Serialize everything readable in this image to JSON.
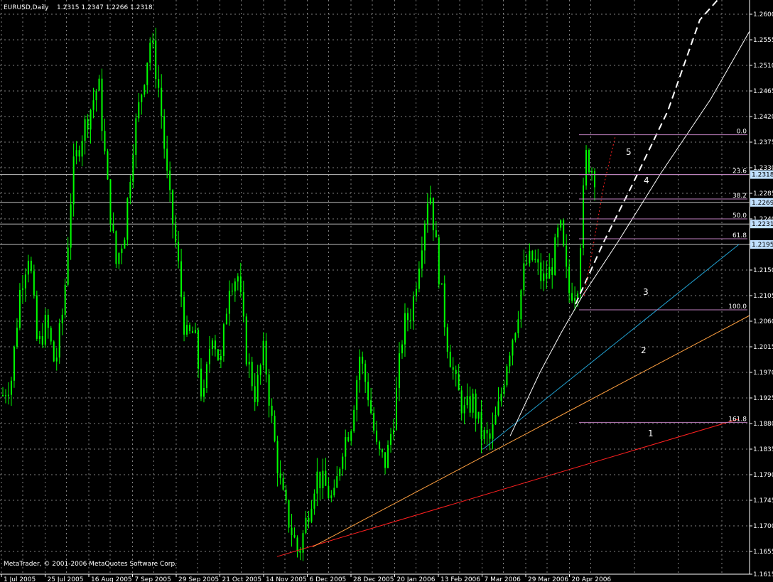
{
  "header": {
    "symbol_text": "EURUSD,Daily",
    "ohlc_text": "1.2315 1.2347 1.2266 1.2318"
  },
  "footer": {
    "copyright": "MetaTrader, © 2001-2006 MetaQuotes Software Corp."
  },
  "chart_data": {
    "type": "candlestick",
    "y_axis": {
      "min": 1.1615,
      "max": 1.2625,
      "ticks": [
        "1.2600",
        "1.2555",
        "1.2510",
        "1.2465",
        "1.2420",
        "1.2375",
        "1.2330",
        "1.2285",
        "1.2240",
        "1.2195",
        "1.2150",
        "1.2105",
        "1.2060",
        "1.2015",
        "1.1970",
        "1.1925",
        "1.1880",
        "1.1835",
        "1.1790",
        "1.1745",
        "1.1700",
        "1.1655",
        "1.1615"
      ]
    },
    "x_axis": {
      "ticks": [
        "1 Jul 2005",
        "25 Jul 2005",
        "16 Aug 2005",
        "7 Sep 2005",
        "29 Sep 2005",
        "21 Oct 2005",
        "14 Nov 2005",
        "6 Dec 2005",
        "28 Dec 2005",
        "20 Jan 2006",
        "13 Feb 2006",
        "7 Mar 2006",
        "29 Mar 2006",
        "20 Apr 2006"
      ]
    },
    "grid": true,
    "series_color": "#00ff00",
    "price_path": [
      1.193,
      1.196,
      1.212,
      1.2185,
      1.201,
      1.206,
      1.198,
      1.209,
      1.232,
      1.2385,
      1.243,
      1.248,
      1.23,
      1.216,
      1.222,
      1.238,
      1.247,
      1.256,
      1.246,
      1.229,
      1.218,
      1.203,
      1.204,
      1.191,
      1.205,
      1.198,
      1.213,
      1.214,
      1.2,
      1.193,
      1.201,
      1.187,
      1.176,
      1.17,
      1.165,
      1.172,
      1.179,
      1.177,
      1.174,
      1.184,
      1.188,
      1.2,
      1.193,
      1.183,
      1.181,
      1.19,
      1.205,
      1.208,
      1.219,
      1.23,
      1.216,
      1.203,
      1.195,
      1.19,
      1.192,
      1.186,
      1.185,
      1.191,
      1.2,
      1.206,
      1.216,
      1.217,
      1.213,
      1.215,
      1.223,
      1.211,
      1.212,
      1.235,
      1.2318
    ],
    "fibonacci": {
      "levels": [
        {
          "label": "0.0",
          "price": 1.2388
        },
        {
          "label": "23.6",
          "price": 1.2318
        },
        {
          "label": "38.2",
          "price": 1.2275
        },
        {
          "label": "50.0",
          "price": 1.224
        },
        {
          "label": "61.8",
          "price": 1.2205
        },
        {
          "label": "100.0",
          "price": 1.208
        },
        {
          "label": "161.8",
          "price": 1.1882
        }
      ]
    },
    "price_badges": [
      "1.2318",
      "1.2269",
      "1.2231",
      "1.2195"
    ],
    "horizontal_lines": [
      1.2318,
      1.2269,
      1.2231,
      1.2195
    ],
    "trendlines": [
      {
        "label": "1",
        "color": "#ff2020",
        "dashed": false
      },
      {
        "label": "2",
        "color": "#ffa040",
        "dashed": false
      },
      {
        "label": "3",
        "color": "#20a0d0",
        "dashed": false
      },
      {
        "label": "4",
        "color": "#ffffff",
        "dashed": false
      },
      {
        "label": "5",
        "color": "#ffffff",
        "dashed": true
      },
      {
        "label": "",
        "color": "#ff2020",
        "dashed": true
      }
    ],
    "colors": {
      "background": "#000000",
      "grid": "#808080",
      "axis": "#ffffff",
      "fib": "#c080c0",
      "hline": "#c0c0c0",
      "badge_bg": "#c0e0ff"
    }
  }
}
